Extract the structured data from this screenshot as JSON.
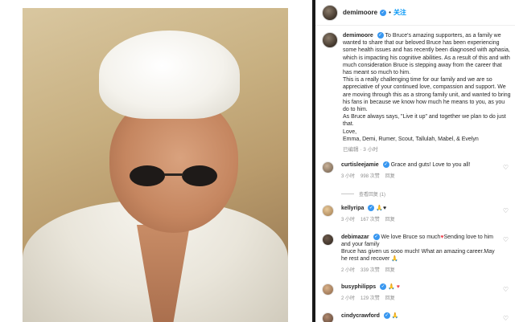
{
  "header": {
    "username": "demimoore",
    "follow_label": "关注",
    "dot": "•"
  },
  "caption": {
    "username": "demimoore",
    "text": "To Bruce's amazing supporters, as a family we wanted to share that our beloved Bruce has been experiencing some health issues and has recently been diagnosed with aphasia, which is impacting his cognitive abilities. As a result of this and with much consideration Bruce is stepping away from the career that has meant so much to him.",
    "text2": "This is a really challenging time for our family and we are so appreciative of your continued love, compassion and support. We are moving through this as a strong family unit, and wanted to bring his fans in because we know how much he means to you, as you do to him.",
    "text3": "As Bruce always says, \"Live it up\" and together we plan to do just that.",
    "text4": "Love,",
    "text5": "Emma, Demi, Rumer, Scout, Tallulah, Mabel, & Evelyn",
    "meta": "已编辑 · 3 小时"
  },
  "comments": [
    {
      "username": "curtisleejamie",
      "text": "Grace and guts! Love to you all!",
      "time": "3 小时",
      "likes": "998 次赞",
      "reply": "回复",
      "view_replies": "查看回复 (1)"
    },
    {
      "username": "kellyripa",
      "text": "🙏♥",
      "time": "3 小时",
      "likes": "167 次赞",
      "reply": "回复"
    },
    {
      "username": "debimazar",
      "text": "We love Bruce so much",
      "text_b": "Sending love to him and your family",
      "text2": "Bruce has given us sooo much! What an amazing career.May he rest and recover 🙏",
      "time": "2 小时",
      "likes": "339 次赞",
      "reply": "回复"
    },
    {
      "username": "busyphilipps",
      "text": "🙏",
      "time": "2 小时",
      "likes": "129 次赞",
      "reply": "回复"
    },
    {
      "username": "cindycrawford",
      "text": "🙏"
    }
  ],
  "icons": {
    "verified": "verified-badge-icon",
    "heart": "heart-outline-icon",
    "red_heart": "red-heart-emoji"
  },
  "colors": {
    "verified_blue": "#3897f0",
    "follow_blue": "#0095f6",
    "meta_gray": "#8e8e8e",
    "heart_red": "#ed4956"
  }
}
